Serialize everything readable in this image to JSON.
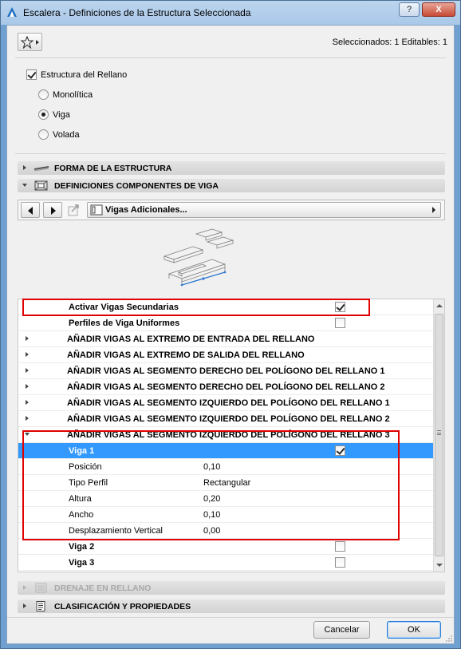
{
  "window": {
    "title": "Escalera - Definiciones de la Estructura Seleccionada",
    "help_label": "?",
    "close_label": "X"
  },
  "selection_info": "Seleccionados: 1 Editables: 1",
  "structure": {
    "checkbox_label": "Estructura del Rellano",
    "checked": true,
    "options": [
      {
        "label": "Monolítica",
        "selected": false
      },
      {
        "label": "Viga",
        "selected": true
      },
      {
        "label": "Volada",
        "selected": false
      }
    ]
  },
  "panels": {
    "forma": "FORMA DE LA ESTRUCTURA",
    "definiciones": "DEFINICIONES COMPONENTES DE VIGA",
    "drenaje": "DRENAJE EN RELLANO",
    "clasificacion": "CLASIFICACIÓN Y PROPIEDADES"
  },
  "nav": {
    "dropdown_value": "Vigas Adicionales..."
  },
  "tree": {
    "rows": [
      {
        "text": "Activar Vigas Secundarias",
        "checked": true
      },
      {
        "text": "Perfiles de Viga Uniformes",
        "checked": false
      },
      {
        "text": "AÑADIR VIGAS AL EXTREMO DE ENTRADA DEL RELLANO"
      },
      {
        "text": "AÑADIR VIGAS AL EXTREMO DE SALIDA DEL RELLANO"
      },
      {
        "text": "AÑADIR VIGAS AL SEGMENTO DERECHO DEL POLÍGONO DEL RELLANO 1"
      },
      {
        "text": "AÑADIR VIGAS AL SEGMENTO DERECHO DEL POLÍGONO DEL RELLANO 2"
      },
      {
        "text": "AÑADIR VIGAS AL SEGMENTO IZQUIERDO DEL POLÍGONO DEL RELLANO 1"
      },
      {
        "text": "AÑADIR VIGAS AL SEGMENTO IZQUIERDO DEL POLÍGONO DEL RELLANO 2"
      },
      {
        "text": "AÑADIR VIGAS AL SEGMENTO IZQUIERDO DEL POLÍGONO DEL RELLANO 3"
      },
      {
        "text": "Viga 1",
        "checked": true
      },
      {
        "text": "Posición",
        "value": "0,10"
      },
      {
        "text": "Tipo Perfil",
        "value": "Rectangular"
      },
      {
        "text": "Altura",
        "value": "0,20"
      },
      {
        "text": "Ancho",
        "value": "0,10"
      },
      {
        "text": "Desplazamiento Vertical",
        "value": "0,00"
      },
      {
        "text": "Viga 2",
        "checked": false
      },
      {
        "text": "Viga 3",
        "checked": false
      }
    ]
  },
  "buttons": {
    "cancel": "Cancelar",
    "ok": "OK"
  },
  "colors": {
    "selection": "#3399ff",
    "highlight_box": "#e00000",
    "title_bar": "#bcd5ee"
  }
}
